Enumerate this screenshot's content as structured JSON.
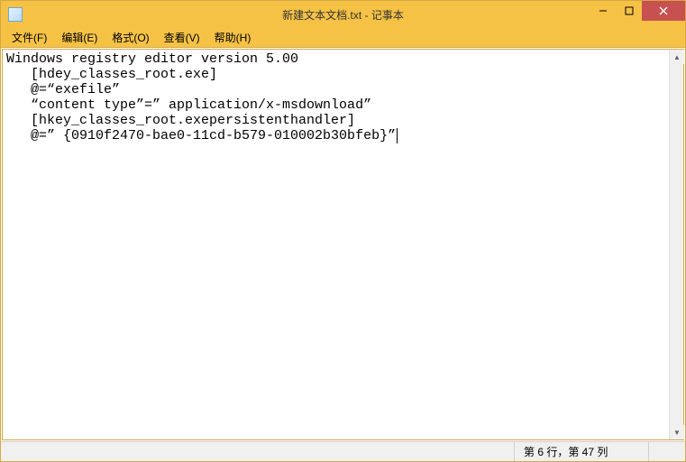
{
  "window": {
    "title": "新建文本文档.txt - 记事本"
  },
  "menu": {
    "items": [
      "文件(F)",
      "编辑(E)",
      "格式(O)",
      "查看(V)",
      "帮助(H)"
    ]
  },
  "editor": {
    "lines": [
      "Windows registry editor version 5.00",
      "   [hdey_classes_root.exe]",
      "   @=“exefile”",
      "   “content type”=” application/x-msdownload”",
      "   [hkey_classes_root.exepersistenthandler]",
      "   @=” {0910f2470-bae0-11cd-b579-010002b30bfeb}”"
    ]
  },
  "status": {
    "pos": "第 6 行，第 47 列"
  }
}
